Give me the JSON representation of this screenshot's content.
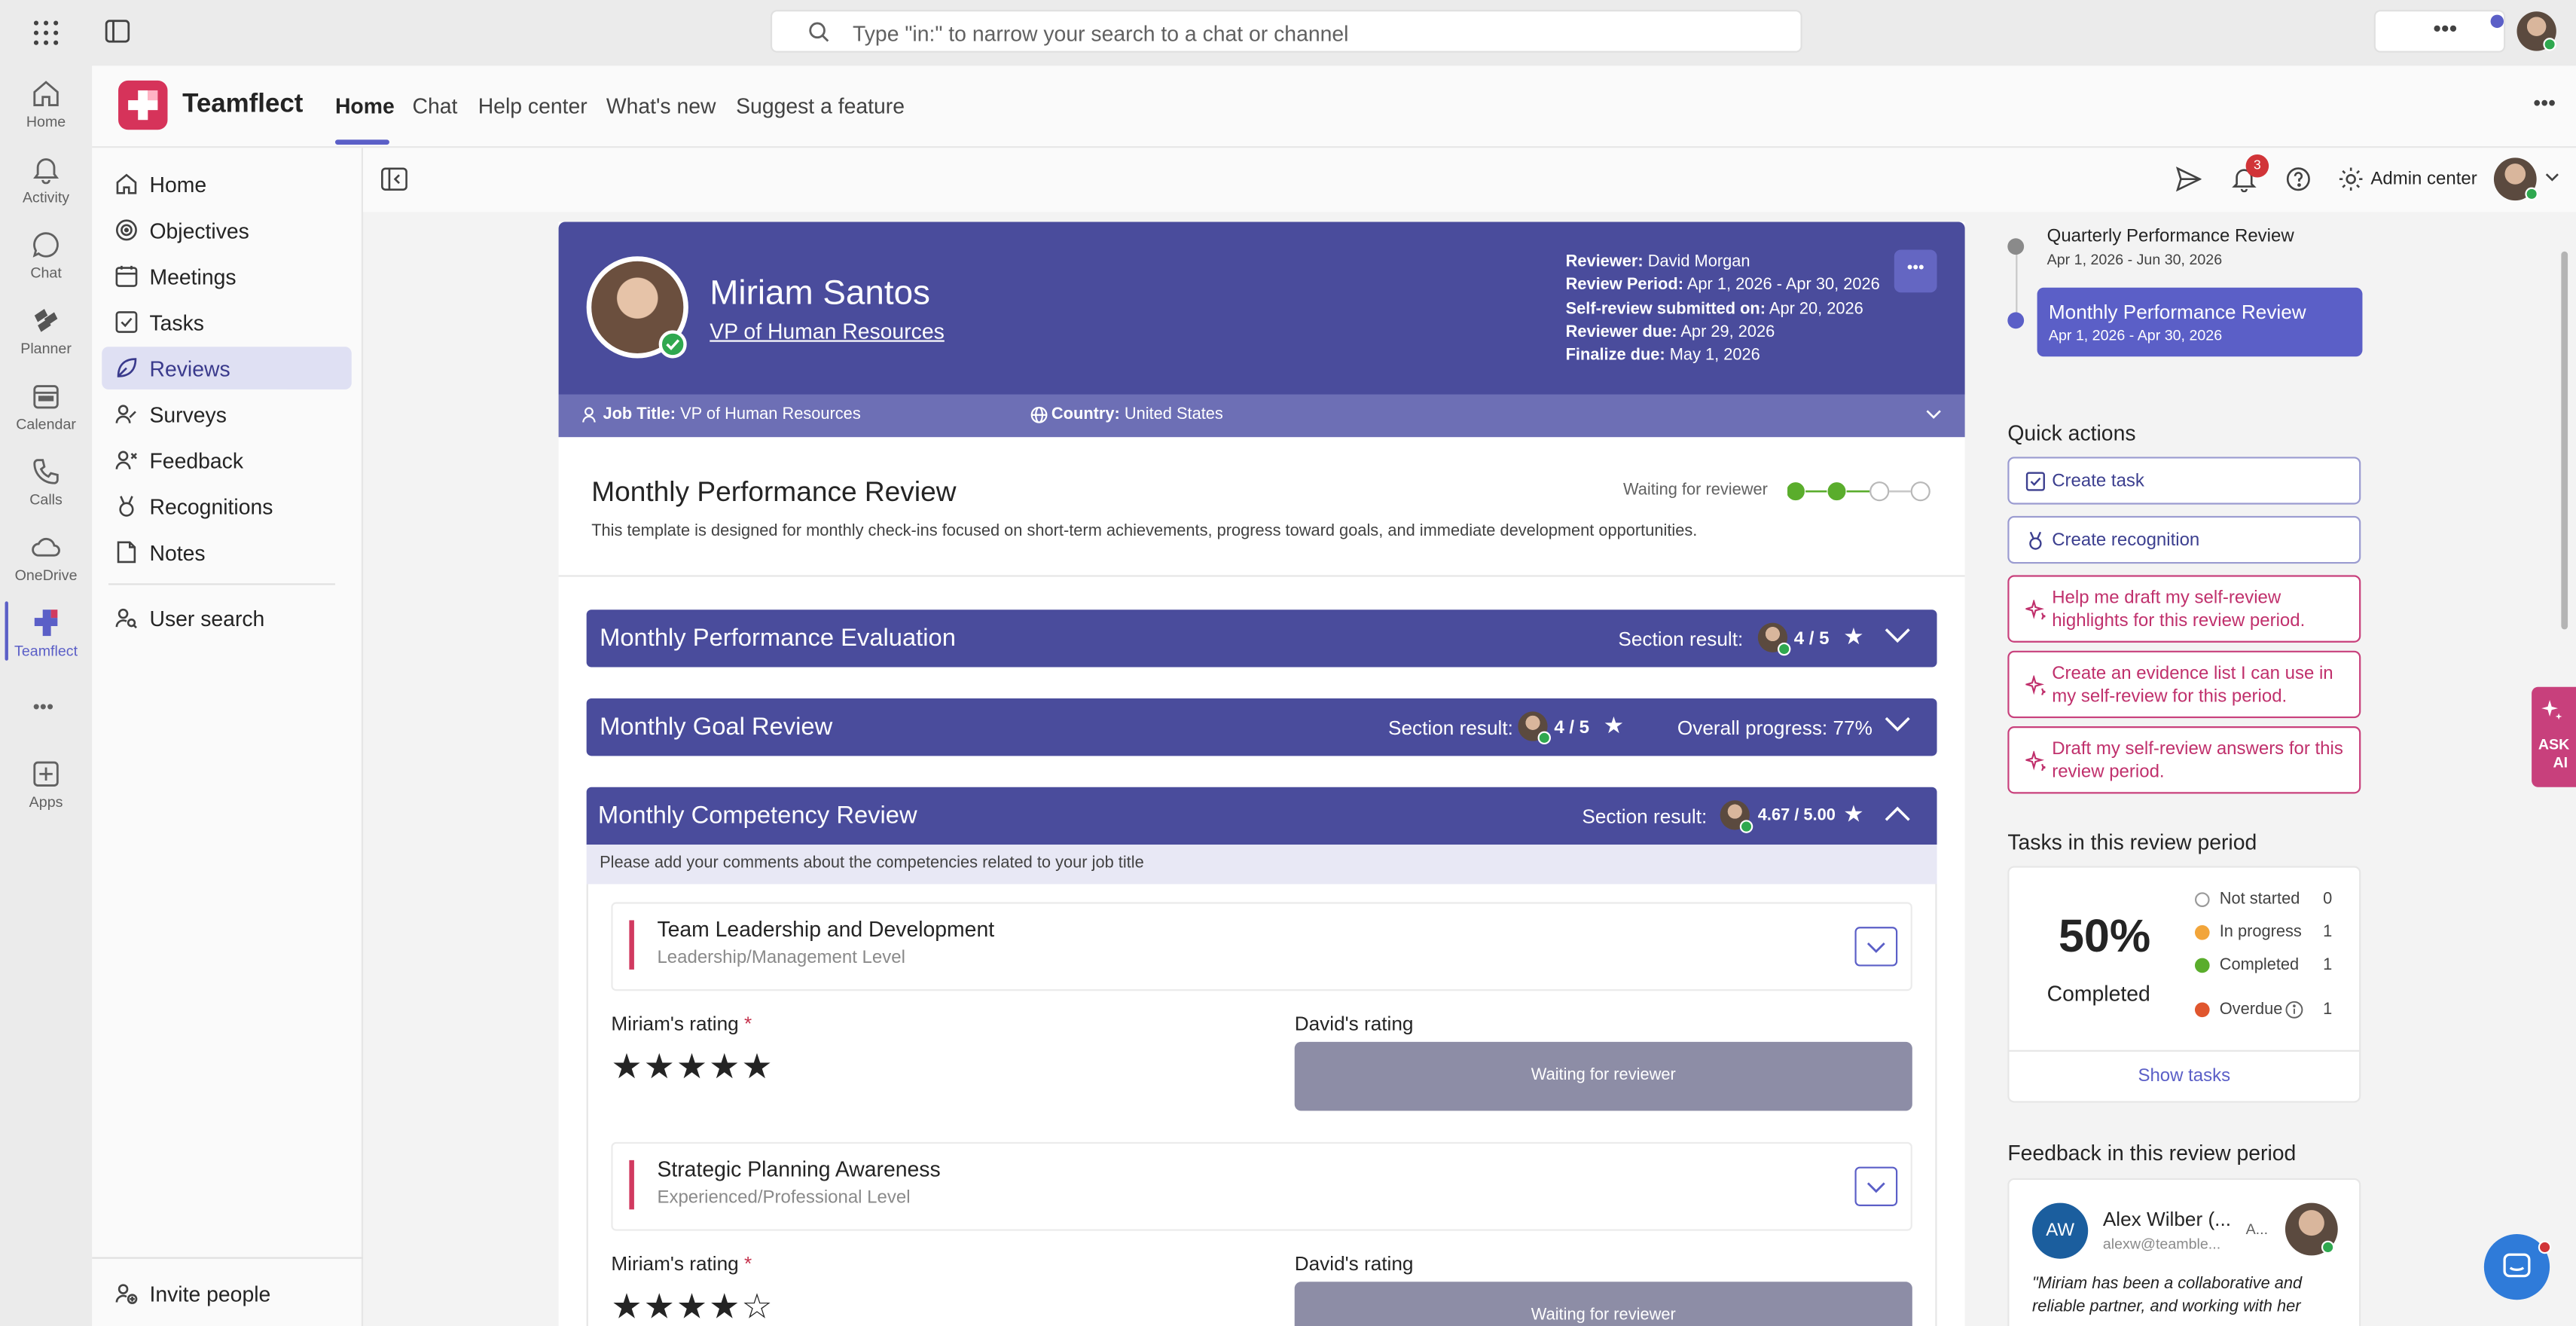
{
  "search": {
    "placeholder": "Type \"in:\" to narrow your search to a chat or channel"
  },
  "rail": {
    "items": [
      {
        "label": "Home",
        "icon": "home-icon"
      },
      {
        "label": "Activity",
        "icon": "bell-icon"
      },
      {
        "label": "Chat",
        "icon": "chat-icon"
      },
      {
        "label": "Planner",
        "icon": "planner-icon"
      },
      {
        "label": "Calendar",
        "icon": "calendar-icon"
      },
      {
        "label": "Calls",
        "icon": "phone-icon"
      },
      {
        "label": "OneDrive",
        "icon": "cloud-icon"
      },
      {
        "label": "Teamflect",
        "icon": "teamflect-icon"
      },
      {
        "label": "Apps",
        "icon": "apps-icon"
      }
    ]
  },
  "app": {
    "name": "Teamflect",
    "tabs": [
      "Home",
      "Chat",
      "Help center",
      "What's new",
      "Suggest a feature"
    ],
    "active_tab": "Home"
  },
  "sidebar": {
    "items": [
      {
        "label": "Home",
        "icon": "home-icon"
      },
      {
        "label": "Objectives",
        "icon": "target-icon"
      },
      {
        "label": "Meetings",
        "icon": "meeting-icon"
      },
      {
        "label": "Tasks",
        "icon": "checkbox-icon"
      },
      {
        "label": "Reviews",
        "icon": "review-icon"
      },
      {
        "label": "Surveys",
        "icon": "survey-icon"
      },
      {
        "label": "Feedback",
        "icon": "feedback-icon"
      },
      {
        "label": "Recognitions",
        "icon": "award-icon"
      },
      {
        "label": "Notes",
        "icon": "note-icon"
      },
      {
        "label": "User search",
        "icon": "user-search-icon"
      }
    ],
    "active": "Reviews",
    "invite_label": "Invite people"
  },
  "toolbar": {
    "notifications_count": "3",
    "admin_center_label": "Admin center"
  },
  "profile": {
    "name": "Miriam Santos",
    "title": "VP of Human Resources",
    "details": [
      {
        "label": "Reviewer:",
        "value": "David Morgan"
      },
      {
        "label": "Review Period:",
        "value": "Apr 1, 2026 - Apr 30, 2026"
      },
      {
        "label": "Self-review submitted on:",
        "value": "Apr 20, 2026"
      },
      {
        "label": "Reviewer due:",
        "value": "Apr 29, 2026"
      },
      {
        "label": "Finalize due:",
        "value": "May 1, 2026"
      }
    ],
    "job_title_label": "Job Title:",
    "job_title_value": "VP of Human Resources",
    "country_label": "Country:",
    "country_value": "United States"
  },
  "review": {
    "title": "Monthly Performance Review",
    "status": "Waiting for reviewer",
    "steps_completed": 2,
    "steps_total": 4,
    "description": "This template is designed for monthly check-ins focused on short-term achievements, progress toward goals, and immediate development opportunities."
  },
  "sections": [
    {
      "title": "Monthly Performance Evaluation",
      "result_label": "Section result:",
      "result": "4 / 5",
      "extra": ""
    },
    {
      "title": "Monthly Goal Review",
      "result_label": "Section result:",
      "result": "4 / 5",
      "extra": "Overall progress: 77%"
    },
    {
      "title": "Monthly Competency Review",
      "result_label": "Section result:",
      "result": "4.67 / 5.00",
      "extra": ""
    }
  ],
  "competency_instructions": "Please add your comments about the competencies related to your job title",
  "competencies": [
    {
      "name": "Team Leadership and Development",
      "level": "Leadership/Management Level",
      "self_label": "Miriam's rating",
      "reviewer_label": "David's rating",
      "stars": "★★★★★",
      "rating": 5,
      "waiting": "Waiting for reviewer"
    },
    {
      "name": "Strategic Planning Awareness",
      "level": "Experienced/Professional Level",
      "self_label": "Miriam's rating",
      "reviewer_label": "David's rating",
      "stars": "★★★★☆",
      "rating": 4,
      "waiting": "Waiting for reviewer"
    }
  ],
  "timeline": [
    {
      "title": "Quarterly Performance Review",
      "dates": "Apr 1, 2026 - Jun 30, 2026"
    },
    {
      "title": "Monthly Performance Review",
      "dates": "Apr 1, 2026 - Apr 30, 2026"
    }
  ],
  "quick_actions": {
    "heading": "Quick actions",
    "items": [
      {
        "label": "Create task",
        "icon": "checkbox-icon"
      },
      {
        "label": "Create recognition",
        "icon": "award-icon"
      },
      {
        "label": "Help me draft my self-review highlights for this review period.",
        "icon": "sparkle-icon"
      },
      {
        "label": "Create an evidence list I can use in my self-review for this period.",
        "icon": "sparkle-icon"
      },
      {
        "label": "Draft my self-review answers for this review period.",
        "icon": "sparkle-icon"
      }
    ]
  },
  "tasks": {
    "heading": "Tasks in this review period",
    "percent": "50%",
    "percent_label": "Completed",
    "legend": [
      {
        "label": "Not started",
        "count": "0",
        "color": "#ffffff"
      },
      {
        "label": "In progress",
        "count": "1",
        "color": "#f2a53a"
      },
      {
        "label": "Completed",
        "count": "1",
        "color": "#5aad2c"
      },
      {
        "label": "Overdue",
        "count": "1",
        "color": "#e0562e"
      }
    ],
    "show_tasks": "Show tasks"
  },
  "feedback": {
    "heading": "Feedback in this review period",
    "initials": "AW",
    "author": "Alex Wilber (...",
    "email": "alexw@teamble...",
    "badge": "A...",
    "quote": "\"Miriam has been a collaborative and reliable partner, and working with her"
  },
  "ask_ai": {
    "line1": "ASK",
    "line2": "AI"
  },
  "colors": {
    "brand": "#4a4c9c",
    "accent": "#5b5fc7",
    "ai": "#c8407c",
    "danger": "#d13a60"
  }
}
